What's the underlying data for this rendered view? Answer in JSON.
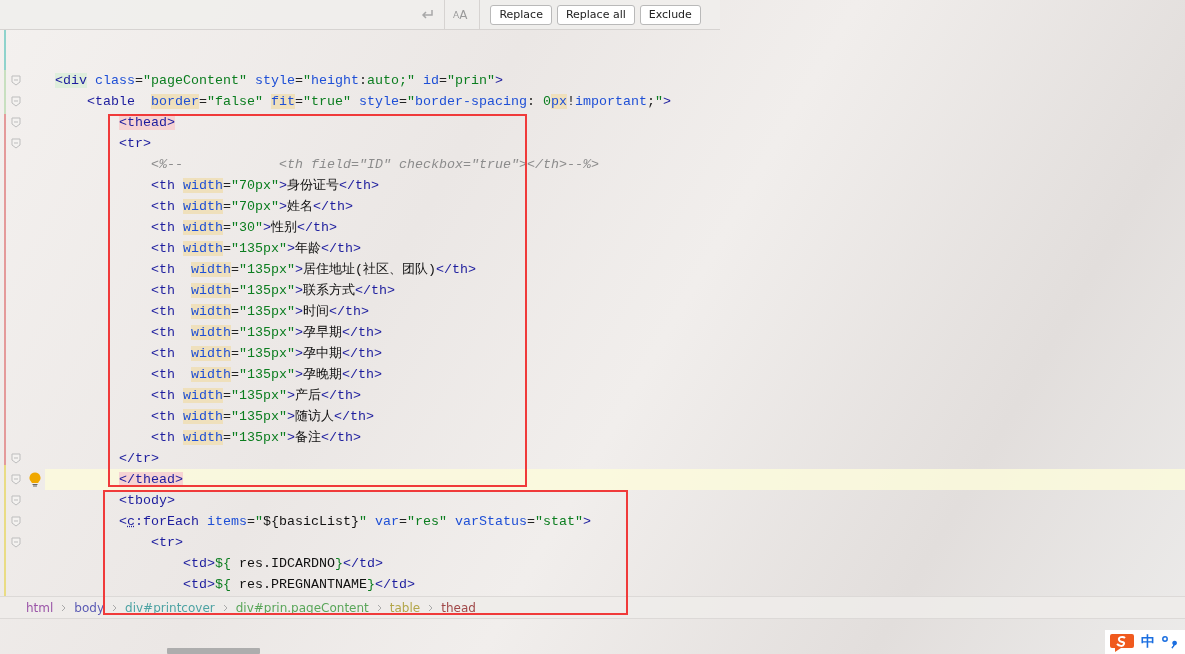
{
  "find_bar": {
    "case_toggle": "AA",
    "buttons": [
      "Replace",
      "Replace all",
      "Exclude"
    ]
  },
  "editor": {
    "lines": [
      {
        "current": false,
        "fold": true,
        "s": [
          {
            "kind": "tag-div",
            "t": "<div"
          },
          {
            "kind": "attr",
            "t": " class"
          },
          {
            "kind": "eq",
            "t": "="
          },
          {
            "kind": "str",
            "t": "\"pageContent\""
          },
          {
            "kind": "attr",
            "t": " style"
          },
          {
            "kind": "eq",
            "t": "="
          },
          {
            "kind": "str",
            "t": "\""
          },
          {
            "kind": "attr",
            "t": "height"
          },
          {
            "kind": "eq",
            "t": ":"
          },
          {
            "kind": "str",
            "t": "auto;\""
          },
          {
            "kind": "attr",
            "t": " id"
          },
          {
            "kind": "eq",
            "t": "="
          },
          {
            "kind": "str",
            "t": "\"prin\""
          },
          {
            "kind": "tag",
            "t": ">"
          }
        ]
      },
      {
        "current": false,
        "fold": true,
        "s": [
          {
            "kind": "tag",
            "t": "    <table  "
          },
          {
            "kind": "attr-hl",
            "t": "border"
          },
          {
            "kind": "eq",
            "t": "="
          },
          {
            "kind": "str",
            "t": "\"false\" "
          },
          {
            "kind": "attr-hl",
            "t": "fit"
          },
          {
            "kind": "eq",
            "t": "="
          },
          {
            "kind": "str",
            "t": "\"true\""
          },
          {
            "kind": "attr",
            "t": " style"
          },
          {
            "kind": "eq",
            "t": "="
          },
          {
            "kind": "str",
            "t": "\""
          },
          {
            "kind": "attr",
            "t": "border-spacing"
          },
          {
            "kind": "eq",
            "t": ": "
          },
          {
            "kind": "str",
            "t": "0"
          },
          {
            "kind": "attr-hl",
            "t": "px"
          },
          {
            "kind": "eq",
            "t": "!"
          },
          {
            "kind": "attr",
            "t": "important"
          },
          {
            "kind": "eq",
            "t": ";"
          },
          {
            "kind": "str",
            "t": "\""
          },
          {
            "kind": "tag",
            "t": ">"
          }
        ]
      },
      {
        "current": false,
        "fold": true,
        "s": [
          {
            "kind": "tag-match",
            "t": "        <thead>"
          }
        ]
      },
      {
        "current": false,
        "fold": true,
        "s": [
          {
            "kind": "tag",
            "t": "        <tr>"
          }
        ]
      },
      {
        "current": false,
        "fold": false,
        "s": [
          {
            "kind": "comment",
            "t": "            <%--            <th field=\"ID\" checkbox=\"true\"></th>--%>"
          }
        ]
      },
      {
        "current": false,
        "fold": false,
        "s": [
          {
            "kind": "tag",
            "t": "            <th "
          },
          {
            "kind": "attr-hl",
            "t": "width"
          },
          {
            "kind": "eq",
            "t": "="
          },
          {
            "kind": "str",
            "t": "\"70px\""
          },
          {
            "kind": "tag",
            "t": ">"
          },
          {
            "kind": "text",
            "t": "身份证号"
          },
          {
            "kind": "tag",
            "t": "</th>"
          }
        ]
      },
      {
        "current": false,
        "fold": false,
        "s": [
          {
            "kind": "tag",
            "t": "            <th "
          },
          {
            "kind": "attr-hl",
            "t": "width"
          },
          {
            "kind": "eq",
            "t": "="
          },
          {
            "kind": "str",
            "t": "\"70px\""
          },
          {
            "kind": "tag",
            "t": ">"
          },
          {
            "kind": "text",
            "t": "姓名"
          },
          {
            "kind": "tag",
            "t": "</th>"
          }
        ]
      },
      {
        "current": false,
        "fold": false,
        "s": [
          {
            "kind": "tag",
            "t": "            <th "
          },
          {
            "kind": "attr-hl",
            "t": "width"
          },
          {
            "kind": "eq",
            "t": "="
          },
          {
            "kind": "str",
            "t": "\"30\""
          },
          {
            "kind": "tag",
            "t": ">"
          },
          {
            "kind": "text",
            "t": "性别"
          },
          {
            "kind": "tag",
            "t": "</th>"
          }
        ]
      },
      {
        "current": false,
        "fold": false,
        "s": [
          {
            "kind": "tag",
            "t": "            <th "
          },
          {
            "kind": "attr-hl",
            "t": "width"
          },
          {
            "kind": "eq",
            "t": "="
          },
          {
            "kind": "str",
            "t": "\"135px\""
          },
          {
            "kind": "tag",
            "t": ">"
          },
          {
            "kind": "text",
            "t": "年龄"
          },
          {
            "kind": "tag",
            "t": "</th>"
          }
        ]
      },
      {
        "current": false,
        "fold": false,
        "s": [
          {
            "kind": "tag",
            "t": "            <th  "
          },
          {
            "kind": "attr-hl",
            "t": "width"
          },
          {
            "kind": "eq",
            "t": "="
          },
          {
            "kind": "str",
            "t": "\"135px\""
          },
          {
            "kind": "tag",
            "t": ">"
          },
          {
            "kind": "text",
            "t": "居住地址(社区、团队)"
          },
          {
            "kind": "tag",
            "t": "</th>"
          }
        ]
      },
      {
        "current": false,
        "fold": false,
        "s": [
          {
            "kind": "tag",
            "t": "            <th  "
          },
          {
            "kind": "attr-hl",
            "t": "width"
          },
          {
            "kind": "eq",
            "t": "="
          },
          {
            "kind": "str",
            "t": "\"135px\""
          },
          {
            "kind": "tag",
            "t": ">"
          },
          {
            "kind": "text",
            "t": "联系方式"
          },
          {
            "kind": "tag",
            "t": "</th>"
          }
        ]
      },
      {
        "current": false,
        "fold": false,
        "s": [
          {
            "kind": "tag",
            "t": "            <th  "
          },
          {
            "kind": "attr-hl",
            "t": "width"
          },
          {
            "kind": "eq",
            "t": "="
          },
          {
            "kind": "str",
            "t": "\"135px\""
          },
          {
            "kind": "tag",
            "t": ">"
          },
          {
            "kind": "text",
            "t": "时间"
          },
          {
            "kind": "tag",
            "t": "</th>"
          }
        ]
      },
      {
        "current": false,
        "fold": false,
        "s": [
          {
            "kind": "tag",
            "t": "            <th  "
          },
          {
            "kind": "attr-hl",
            "t": "width"
          },
          {
            "kind": "eq",
            "t": "="
          },
          {
            "kind": "str",
            "t": "\"135px\""
          },
          {
            "kind": "tag",
            "t": ">"
          },
          {
            "kind": "text",
            "t": "孕早期"
          },
          {
            "kind": "tag",
            "t": "</th>"
          }
        ]
      },
      {
        "current": false,
        "fold": false,
        "s": [
          {
            "kind": "tag",
            "t": "            <th  "
          },
          {
            "kind": "attr-hl",
            "t": "width"
          },
          {
            "kind": "eq",
            "t": "="
          },
          {
            "kind": "str",
            "t": "\"135px\""
          },
          {
            "kind": "tag",
            "t": ">"
          },
          {
            "kind": "text",
            "t": "孕中期"
          },
          {
            "kind": "tag",
            "t": "</th>"
          }
        ]
      },
      {
        "current": false,
        "fold": false,
        "s": [
          {
            "kind": "tag",
            "t": "            <th  "
          },
          {
            "kind": "attr-hl",
            "t": "width"
          },
          {
            "kind": "eq",
            "t": "="
          },
          {
            "kind": "str",
            "t": "\"135px\""
          },
          {
            "kind": "tag",
            "t": ">"
          },
          {
            "kind": "text",
            "t": "孕晚期"
          },
          {
            "kind": "tag",
            "t": "</th>"
          }
        ]
      },
      {
        "current": false,
        "fold": false,
        "s": [
          {
            "kind": "tag",
            "t": "            <th "
          },
          {
            "kind": "attr-hl",
            "t": "width"
          },
          {
            "kind": "eq",
            "t": "="
          },
          {
            "kind": "str",
            "t": "\"135px\""
          },
          {
            "kind": "tag",
            "t": ">"
          },
          {
            "kind": "text",
            "t": "产后"
          },
          {
            "kind": "tag",
            "t": "</th>"
          }
        ]
      },
      {
        "current": false,
        "fold": false,
        "s": [
          {
            "kind": "tag",
            "t": "            <th "
          },
          {
            "kind": "attr-hl",
            "t": "width"
          },
          {
            "kind": "eq",
            "t": "="
          },
          {
            "kind": "str",
            "t": "\"135px\""
          },
          {
            "kind": "tag",
            "t": ">"
          },
          {
            "kind": "text",
            "t": "随访人"
          },
          {
            "kind": "tag",
            "t": "</th>"
          }
        ]
      },
      {
        "current": false,
        "fold": false,
        "s": [
          {
            "kind": "tag",
            "t": "            <th "
          },
          {
            "kind": "attr-hl",
            "t": "width"
          },
          {
            "kind": "eq",
            "t": "="
          },
          {
            "kind": "str",
            "t": "\"135px\""
          },
          {
            "kind": "tag",
            "t": ">"
          },
          {
            "kind": "text",
            "t": "备注"
          },
          {
            "kind": "tag",
            "t": "</th>"
          }
        ]
      },
      {
        "current": false,
        "fold": true,
        "s": [
          {
            "kind": "tag",
            "t": "        </tr>"
          }
        ]
      },
      {
        "current": true,
        "fold": true,
        "s": [
          {
            "kind": "tag-match",
            "t": "        </thead>"
          }
        ]
      },
      {
        "current": false,
        "fold": true,
        "s": [
          {
            "kind": "tag",
            "t": "        <tbody>"
          }
        ]
      },
      {
        "current": false,
        "fold": true,
        "s": [
          {
            "kind": "tag",
            "t": "        <"
          },
          {
            "kind": "tag-ns",
            "t": "c"
          },
          {
            "kind": "tag",
            "t": ":forEach "
          },
          {
            "kind": "attr",
            "t": "items"
          },
          {
            "kind": "eq",
            "t": "="
          },
          {
            "kind": "str",
            "t": "\""
          },
          {
            "kind": "text",
            "t": "${basicList}"
          },
          {
            "kind": "str",
            "t": "\" "
          },
          {
            "kind": "attr",
            "t": "var"
          },
          {
            "kind": "eq",
            "t": "="
          },
          {
            "kind": "str",
            "t": "\"res\" "
          },
          {
            "kind": "attr",
            "t": "varStatus"
          },
          {
            "kind": "eq",
            "t": "="
          },
          {
            "kind": "str",
            "t": "\"stat\""
          },
          {
            "kind": "tag",
            "t": ">"
          }
        ]
      },
      {
        "current": false,
        "fold": true,
        "s": [
          {
            "kind": "tag",
            "t": "            <tr>"
          }
        ]
      },
      {
        "current": false,
        "fold": false,
        "s": [
          {
            "kind": "tag",
            "t": "                <td>"
          },
          {
            "kind": "str",
            "t": "${"
          },
          {
            "kind": "text",
            "t": " res.IDCARDNO"
          },
          {
            "kind": "str",
            "t": "}"
          },
          {
            "kind": "tag",
            "t": "</td>"
          }
        ]
      },
      {
        "current": false,
        "fold": false,
        "s": [
          {
            "kind": "tag",
            "t": "                <td>"
          },
          {
            "kind": "str",
            "t": "${"
          },
          {
            "kind": "text",
            "t": " res.PREGNANTNAME"
          },
          {
            "kind": "str",
            "t": "}"
          },
          {
            "kind": "tag",
            "t": "</td>"
          }
        ]
      }
    ]
  },
  "breadcrumbs": [
    {
      "label": "html",
      "color": "#9b55a8"
    },
    {
      "label": "body",
      "color": "#5a5ab4"
    },
    {
      "label": "div#printcover",
      "color": "#4ea3a3"
    },
    {
      "label": "div#prin.pageContent",
      "color": "#5aa65a"
    },
    {
      "label": "table",
      "color": "#b3a64a"
    },
    {
      "label": "thead",
      "color": "#a04848"
    }
  ],
  "ime": {
    "mode": "中"
  }
}
